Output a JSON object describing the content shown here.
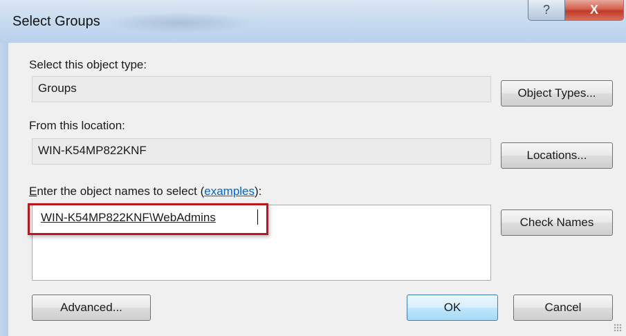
{
  "window": {
    "title": "Select Groups",
    "help_glyph": "?",
    "close_glyph": "X"
  },
  "object_type": {
    "label": "Select this object type:",
    "value": "Groups",
    "button_label": "Object Types..."
  },
  "location": {
    "label": "From this location:",
    "value": "WIN-K54MP822KNF",
    "button_label": "Locations..."
  },
  "names": {
    "label_accel": "E",
    "label_rest": "nter the object names to select (",
    "link_text": "examples",
    "label_end": "):",
    "value": "WIN-K54MP822KNF\\WebAdmins",
    "check_button_label": "Check Names"
  },
  "footer": {
    "advanced_label": "Advanced...",
    "ok_label": "OK",
    "cancel_label": "Cancel"
  },
  "colors": {
    "highlight": "#c0141c",
    "link": "#0066cc"
  }
}
